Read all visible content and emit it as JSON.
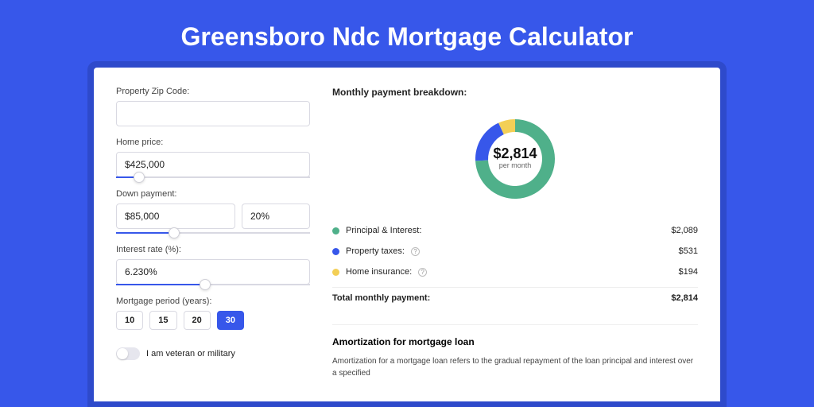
{
  "page_title": "Greensboro Ndc Mortgage Calculator",
  "form": {
    "zip_label": "Property Zip Code:",
    "zip_value": "",
    "home_price_label": "Home price:",
    "home_price_value": "$425,000",
    "home_price_pct": 12,
    "down_label": "Down payment:",
    "down_amount": "$85,000",
    "down_pct_value": "20%",
    "down_pct": 30,
    "rate_label": "Interest rate (%):",
    "rate_value": "6.230%",
    "rate_pct": 46,
    "period_label": "Mortgage period (years):",
    "periods": [
      "10",
      "15",
      "20",
      "30"
    ],
    "period_selected": "30",
    "veteran_label": "I am veteran or military",
    "veteran_on": false
  },
  "breakdown": {
    "header": "Monthly payment breakdown:",
    "center_amount": "$2,814",
    "center_sub": "per month",
    "items": [
      {
        "label": "Principal & Interest:",
        "value": "$2,089",
        "color": "#4fb08a"
      },
      {
        "label": "Property taxes:",
        "value": "$531",
        "color": "#3757ea",
        "help": true
      },
      {
        "label": "Home insurance:",
        "value": "$194",
        "color": "#f3cf56",
        "help": true
      }
    ],
    "total_label": "Total monthly payment:",
    "total_value": "$2,814"
  },
  "amortization": {
    "title": "Amortization for mortgage loan",
    "body": "Amortization for a mortgage loan refers to the gradual repayment of the loan principal and interest over a specified"
  },
  "chart_data": {
    "type": "pie",
    "title": "Monthly payment breakdown",
    "series": [
      {
        "name": "Principal & Interest",
        "value": 2089,
        "color": "#4fb08a"
      },
      {
        "name": "Property taxes",
        "value": 531,
        "color": "#3757ea"
      },
      {
        "name": "Home insurance",
        "value": 194,
        "color": "#f3cf56"
      }
    ],
    "total": 2814
  }
}
